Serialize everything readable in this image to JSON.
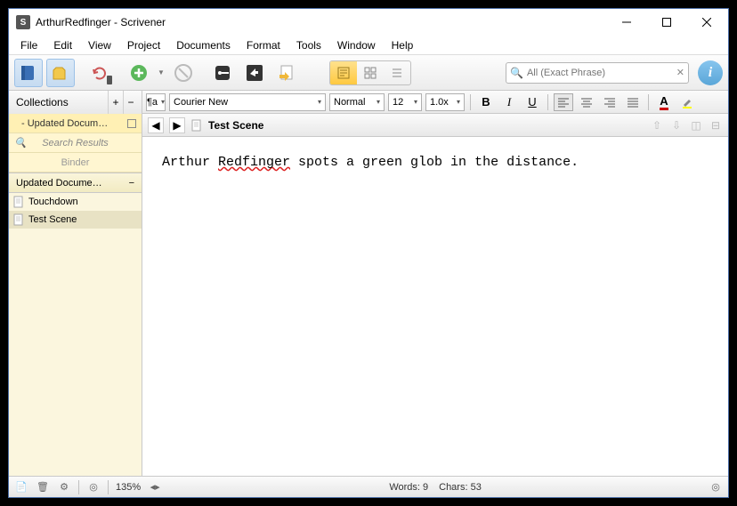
{
  "window": {
    "title": "ArthurRedfinger - Scrivener"
  },
  "menu": {
    "items": [
      "File",
      "Edit",
      "View",
      "Project",
      "Documents",
      "Format",
      "Tools",
      "Window",
      "Help"
    ]
  },
  "search": {
    "placeholder": "All (Exact Phrase)"
  },
  "collections": {
    "header": "Collections",
    "updated_short": "- Updated Docum…",
    "searchresults": "Search Results",
    "binder": "Binder",
    "subheader": "Updated Docume…",
    "items": [
      "Touchdown",
      "Test Scene"
    ]
  },
  "formatbar": {
    "font": "Courier New",
    "preset": "Normal",
    "size": "12",
    "zoomline": "1.0x"
  },
  "doc": {
    "title": "Test Scene"
  },
  "editor": {
    "pre": "Arthur ",
    "wavy": "Redfinger",
    "post": " spots a green glob in the distance."
  },
  "status": {
    "zoom": "135%",
    "words": "Words: 9",
    "chars": "Chars: 53"
  }
}
